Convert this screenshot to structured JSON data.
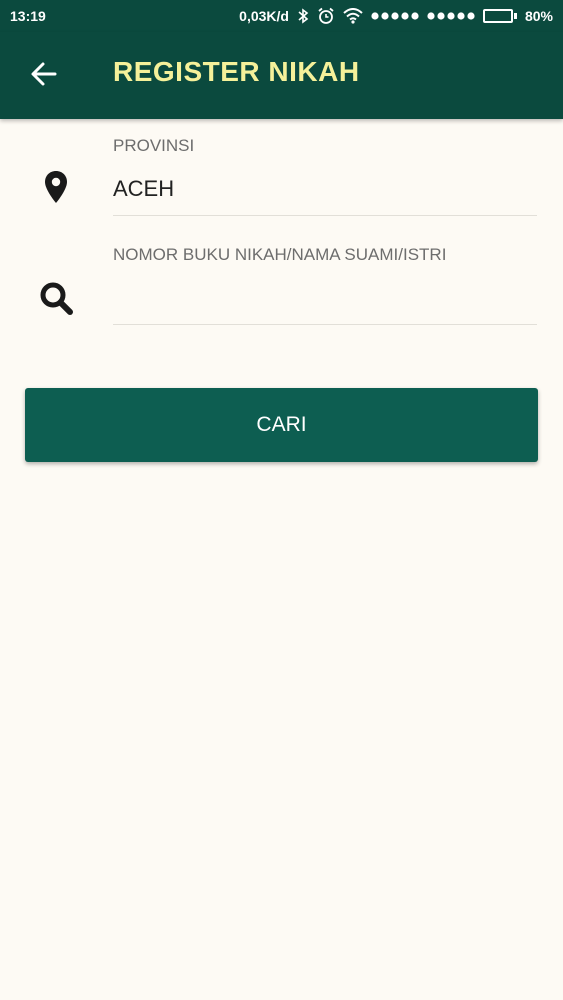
{
  "status_bar": {
    "time": "13:19",
    "network_speed": "0,03K/d",
    "battery_percent": "80%",
    "battery_level": 0.8,
    "icons": [
      "bluetooth-icon",
      "alarm-icon",
      "wifi-icon",
      "signal-dots-icon",
      "signal-dots-icon",
      "battery-icon"
    ]
  },
  "app_bar": {
    "title": "REGISTER NIKAH",
    "back_icon": "arrow-left-icon"
  },
  "form": {
    "provinsi": {
      "label": "PROVINSI",
      "value": "ACEH",
      "icon": "map-marker-icon"
    },
    "search": {
      "label": "NOMOR BUKU NIKAH/NAMA SUAMI/ISTRI",
      "value": "",
      "icon": "search-icon"
    }
  },
  "actions": {
    "search_button_label": "CARI"
  },
  "colors": {
    "primary": "#0b4a3e",
    "button": "#0d5e51",
    "title_accent": "#f5f19a",
    "background": "#fdfaf4"
  }
}
